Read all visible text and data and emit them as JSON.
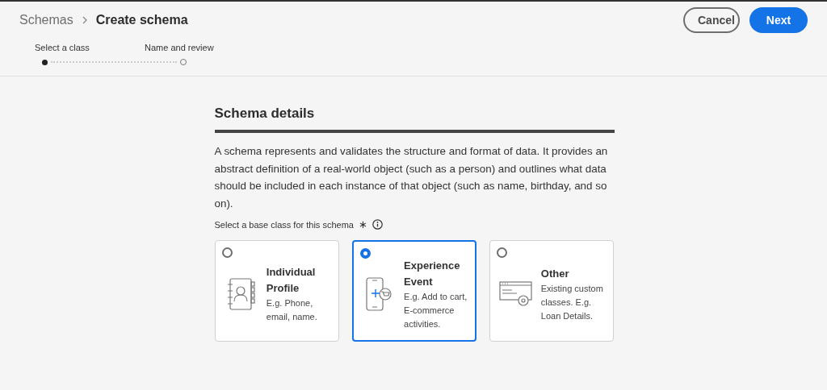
{
  "breadcrumb": {
    "parent": "Schemas",
    "current": "Create schema"
  },
  "buttons": {
    "cancel": "Cancel",
    "next": "Next"
  },
  "steps": [
    {
      "label": "Select a class",
      "selected": true
    },
    {
      "label": "Name and review",
      "selected": false
    }
  ],
  "section": {
    "title": "Schema details",
    "description": "A schema represents and validates the structure and format of data. It provides an abstract definition of a real-world object (such as a person) and outlines what data should be included in each instance of that object (such as name, birthday, and so on).",
    "field_label": "Select a base class for this schema",
    "required_mark": "∗"
  },
  "classes": [
    {
      "kind": "profile",
      "title": "Individual Profile",
      "description": "E.g. Phone, email, name.",
      "selected": false
    },
    {
      "kind": "event",
      "title": "Experience Event",
      "description": "E.g. Add to cart, E-commerce activities.",
      "selected": true
    },
    {
      "kind": "other",
      "title": "Other",
      "description": "Existing custom classes. E.g. Loan Details.",
      "selected": false
    }
  ]
}
